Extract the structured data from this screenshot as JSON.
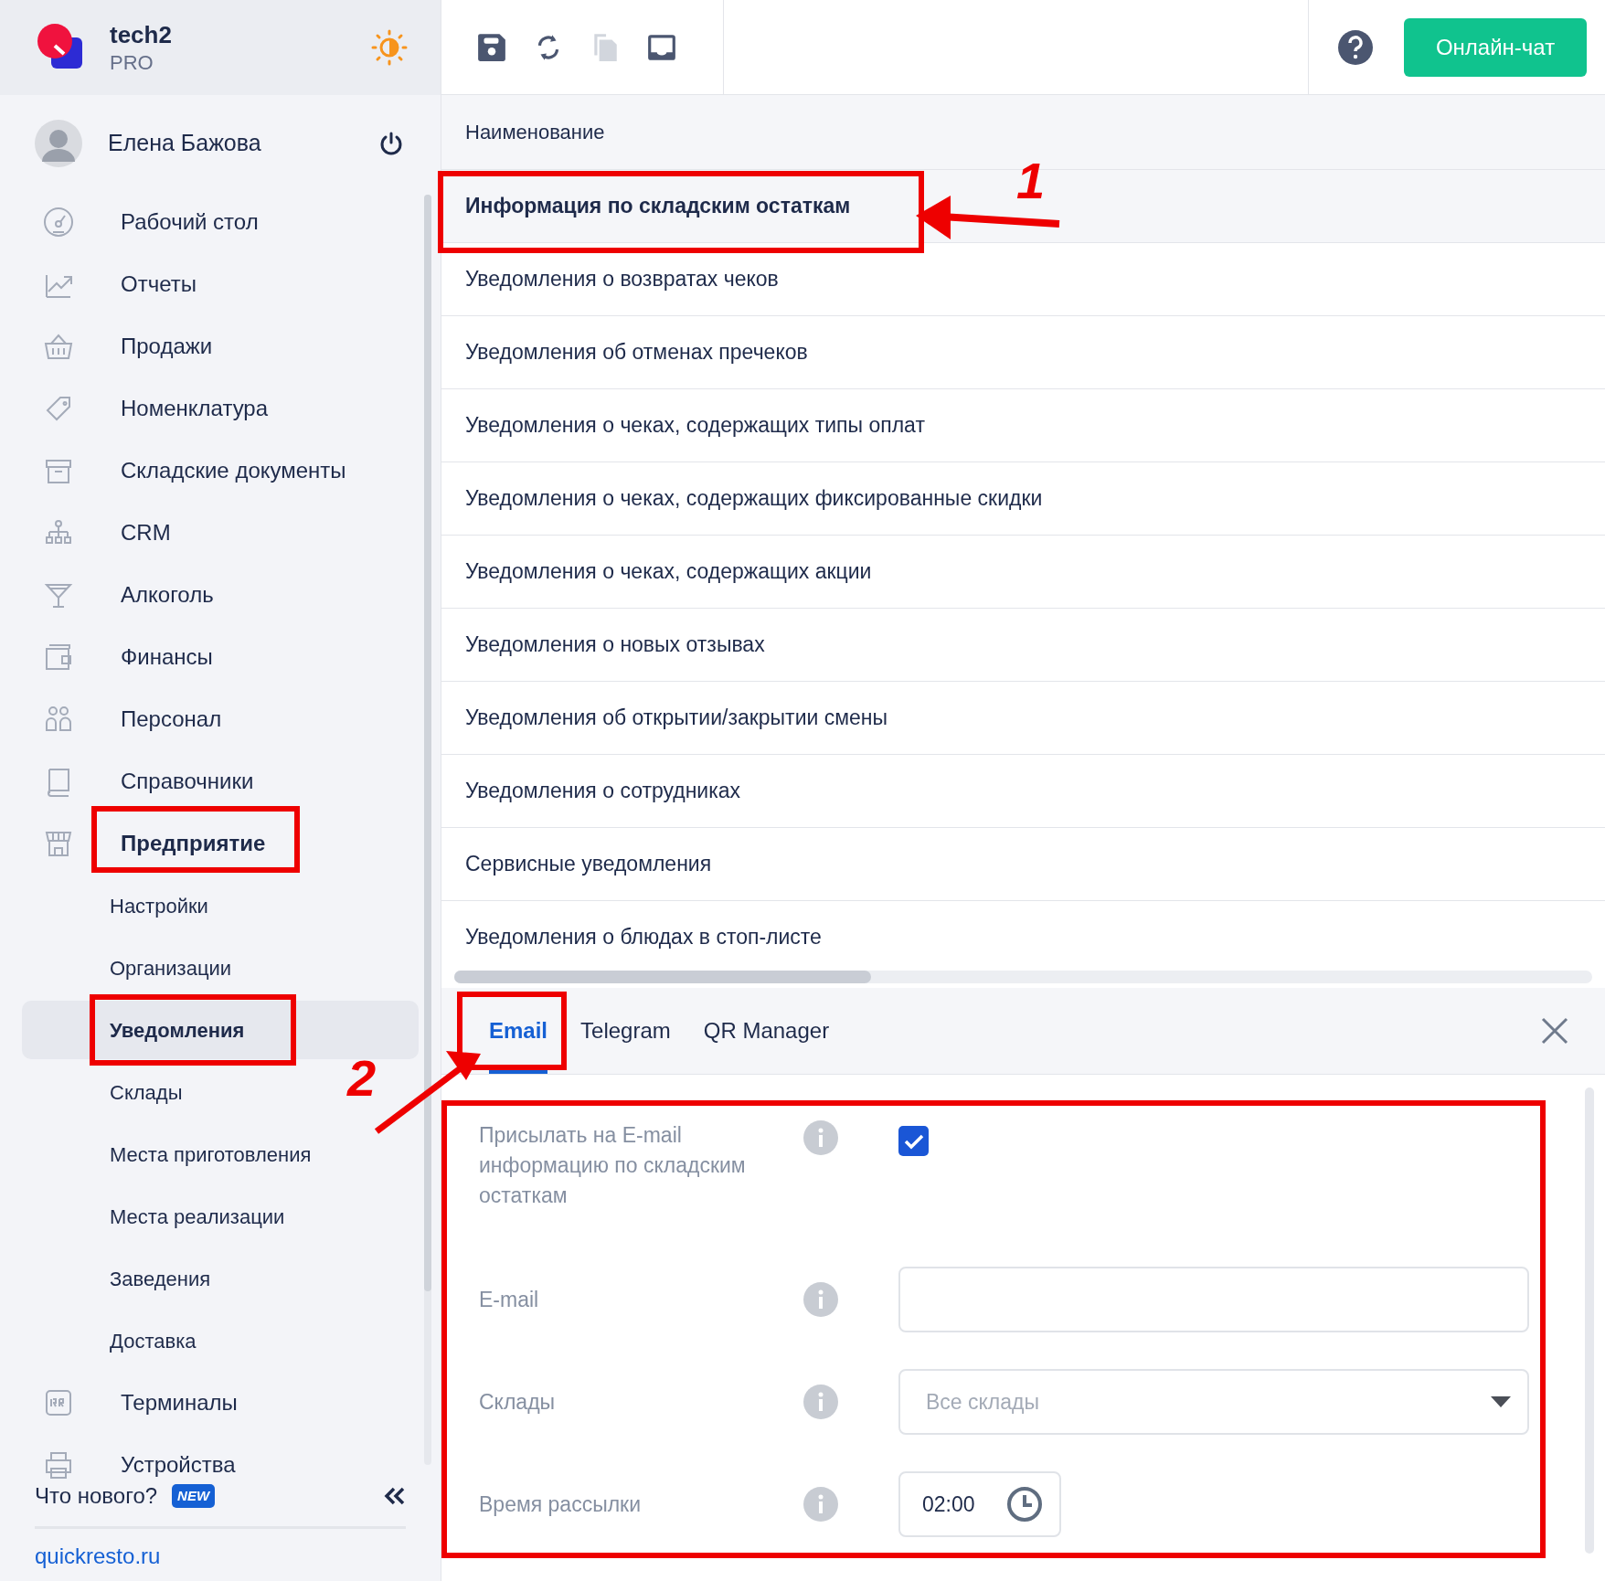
{
  "app": {
    "name": "tech2",
    "plan": "PRO"
  },
  "user": {
    "name": "Елена Бажова"
  },
  "sidebar": {
    "items": [
      {
        "label": "Рабочий стол",
        "selected": false
      },
      {
        "label": "Отчеты",
        "selected": false
      },
      {
        "label": "Продажи",
        "selected": false
      },
      {
        "label": "Номенклатура",
        "selected": false
      },
      {
        "label": "Складские документы",
        "selected": false
      },
      {
        "label": "CRM",
        "selected": false
      },
      {
        "label": "Алкоголь",
        "selected": false
      },
      {
        "label": "Финансы",
        "selected": false
      },
      {
        "label": "Персонал",
        "selected": false
      },
      {
        "label": "Справочники",
        "selected": false
      },
      {
        "label": "Предприятие",
        "selected": false,
        "expanded": true,
        "children": [
          {
            "label": "Настройки",
            "selected": false
          },
          {
            "label": "Организации",
            "selected": false
          },
          {
            "label": "Уведомления",
            "selected": true
          },
          {
            "label": "Склады",
            "selected": false
          },
          {
            "label": "Места приготовления",
            "selected": false
          },
          {
            "label": "Места реализации",
            "selected": false
          },
          {
            "label": "Заведения",
            "selected": false
          },
          {
            "label": "Доставка",
            "selected": false
          }
        ]
      },
      {
        "label": "Терминалы",
        "selected": false
      },
      {
        "label": "Устройства",
        "selected": false
      }
    ],
    "whats_new": "Что нового?",
    "new_badge": "NEW",
    "link": "quickresto.ru"
  },
  "toolbar": {
    "buttons": [
      {
        "disabled": false
      },
      {
        "disabled": false
      },
      {
        "disabled": true
      },
      {
        "disabled": false
      }
    ],
    "chat_button": "Онлайн-чат"
  },
  "table": {
    "column": "Наименование",
    "rows": [
      {
        "name": "Информация по складским остаткам",
        "selected": true
      },
      {
        "name": "Уведомления о возвратах чеков",
        "selected": false
      },
      {
        "name": "Уведомления об отменах пречеков",
        "selected": false
      },
      {
        "name": "Уведомления о чеках, содержащих типы оплат",
        "selected": false
      },
      {
        "name": "Уведомления о чеках, содержащих фиксированные скидки",
        "selected": false
      },
      {
        "name": "Уведомления о чеках, содержащих акции",
        "selected": false
      },
      {
        "name": "Уведомления о новых отзывах",
        "selected": false
      },
      {
        "name": "Уведомления об открытии/закрытии смены",
        "selected": false
      },
      {
        "name": "Уведомления о сотрудниках",
        "selected": false
      },
      {
        "name": "Сервисные уведомления",
        "selected": false
      },
      {
        "name": "Уведомления о блюдах в стоп-листе",
        "selected": false
      }
    ]
  },
  "detail": {
    "tabs": [
      {
        "label": "Email",
        "selected": true
      },
      {
        "label": "Telegram",
        "selected": false
      },
      {
        "label": "QR Manager",
        "selected": false
      }
    ],
    "fields": [
      {
        "kind": "checkbox",
        "label": "Присылать на E-mail информацию по складским остаткам",
        "checked": true
      },
      {
        "kind": "text",
        "label": "E-mail"
      },
      {
        "kind": "select",
        "label": "Склады",
        "placeholder": "Все склады"
      },
      {
        "kind": "time",
        "label": "Время рассылки",
        "value": "02:00"
      }
    ]
  },
  "annotations": [
    {
      "label": "1"
    },
    {
      "label": "2"
    }
  ]
}
